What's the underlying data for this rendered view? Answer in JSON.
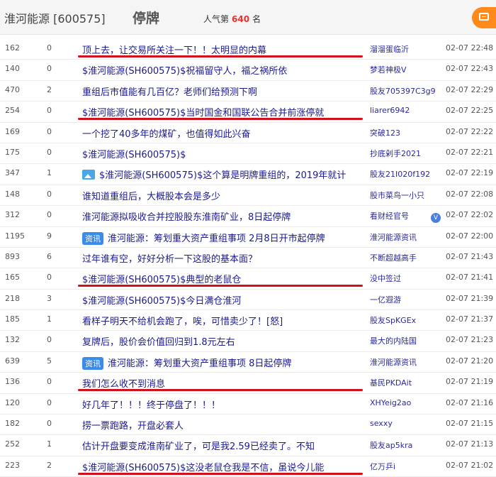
{
  "header": {
    "stock_name": "淮河能源 [600575]",
    "status": "停牌",
    "popularity_label": "人气第",
    "popularity_rank": "640",
    "popularity_suffix": "名"
  },
  "posts": [
    {
      "read": "162",
      "reply": "0",
      "title": "顶上去，让交易所关注一下！！太明显的内幕",
      "author": "溜溜蛋临沂",
      "time": "02-07 22:48",
      "underlined": true
    },
    {
      "read": "140",
      "reply": "0",
      "title": "$淮河能源(SH600575)$祝福留守人，福之祸所依",
      "author": "梦若神极V",
      "time": "02-07 22:43"
    },
    {
      "read": "470",
      "reply": "2",
      "title": "重组后市值能有几百亿？老师们给预测下啊",
      "author": "股友705397C3g9",
      "time": "02-07 22:29"
    },
    {
      "read": "254",
      "reply": "0",
      "title": "$淮河能源(SH600575)$当时国金和国联公告合并前涨停就",
      "author": "liarer6942",
      "time": "02-07 22:25",
      "underlined": true
    },
    {
      "read": "169",
      "reply": "0",
      "title": "一个挖了40多年的煤矿，也值得如此兴奋",
      "author": "突破123",
      "time": "02-07 22:22"
    },
    {
      "read": "175",
      "reply": "0",
      "title": "$淮河能源(SH600575)$",
      "author": "抄底剁手2021",
      "time": "02-07 22:21"
    },
    {
      "read": "347",
      "reply": "1",
      "title": "$淮河能源(SH600575)$这个算是明牌重组的，2019年就计",
      "author": "股友21I020f192",
      "time": "02-07 22:19",
      "img": true
    },
    {
      "read": "148",
      "reply": "0",
      "title": "谁知道重组后，大概股本会是多少",
      "author": "股市菜鸟一小只",
      "time": "02-07 22:08"
    },
    {
      "read": "312",
      "reply": "0",
      "title": "淮河能源拟吸收合并控股股东淮南矿业，8日起停牌",
      "author": "看财经官号",
      "time": "02-07 22:02",
      "verified": true
    },
    {
      "read": "1195",
      "reply": "9",
      "title": "淮河能源：筹划重大资产重组事项 2月8日开市起停牌",
      "author": "淮河能源资讯",
      "time": "02-07 22:00",
      "zixun": "资讯"
    },
    {
      "read": "893",
      "reply": "6",
      "title": "过年谁有空，好好分析一下这股的基本面？",
      "author": "不断超越高手",
      "time": "02-07 21:43"
    },
    {
      "read": "165",
      "reply": "0",
      "title": "$淮河能源(SH600575)$典型的老鼠仓",
      "author": "没中签过",
      "time": "02-07 21:41",
      "underlined": true
    },
    {
      "read": "218",
      "reply": "3",
      "title": "$淮河能源(SH600575)$今日满仓淮河",
      "author": "一亿遐游",
      "time": "02-07 21:39"
    },
    {
      "read": "185",
      "reply": "1",
      "title": "看样子明天不给机会跑了，唉，可惜卖少了！[怒]",
      "author": "股友SpKGEx",
      "time": "02-07 21:37"
    },
    {
      "read": "132",
      "reply": "0",
      "title": "复牌后，股价会价值回归到1.8元左右",
      "author": "最大的内陆国",
      "time": "02-07 21:23"
    },
    {
      "read": "639",
      "reply": "5",
      "title": "淮河能源：筹划重大资产重组事项 8日起停牌",
      "author": "淮河能源资讯",
      "time": "02-07 21:20",
      "zixun": "资讯"
    },
    {
      "read": "136",
      "reply": "0",
      "title": "我们怎么收不到消息",
      "author": "基民PKDAit",
      "time": "02-07 21:19",
      "underlined": true
    },
    {
      "read": "120",
      "reply": "0",
      "title": "好几年了！！！终于停盘了！！！",
      "author": "XHYeig2ao",
      "time": "02-07 21:16"
    },
    {
      "read": "182",
      "reply": "0",
      "title": "捞一票跑路，开盘必套人",
      "author": "sexxy",
      "time": "02-07 21:15"
    },
    {
      "read": "252",
      "reply": "1",
      "title": "估计开盘要变成淮南矿业了，可是我2.59已经卖了。不知",
      "author": "股友ap5kra",
      "time": "02-07 21:13"
    },
    {
      "read": "223",
      "reply": "2",
      "title": "$淮河能源(SH600575)$这没老鼠仓我是不信，虽说今儿能",
      "author": "亿万乒i",
      "time": "02-07 21:02",
      "underlined": true
    }
  ],
  "colors": {
    "underline": "#d0101a",
    "accent": "#ff8a1a",
    "rank": "#e8322c"
  },
  "icons": {
    "post_button": "edit-icon",
    "image_post": "image-icon",
    "verified": "verified-v-icon"
  }
}
